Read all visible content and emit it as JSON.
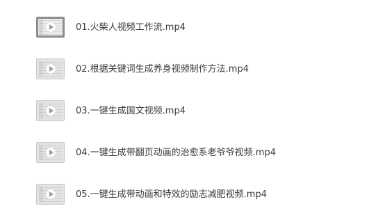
{
  "files": [
    {
      "name": "01.火柴人视频工作流.mp4",
      "thumbnail_icon": "video-thumbnail-icon"
    },
    {
      "name": "02.根据关键词生成养身视频制作方法.mp4",
      "thumbnail_icon": "video-thumbnail-icon"
    },
    {
      "name": "03.一键生成国文视频.mp4",
      "thumbnail_icon": "video-thumbnail-icon"
    },
    {
      "name": "04.一键生成带翻页动画的治愈系老爷爷视频.mp4",
      "thumbnail_icon": "video-thumbnail-icon"
    },
    {
      "name": "05.一键生成带动画和特效的励志减肥视频.mp4",
      "thumbnail_icon": "video-thumbnail-icon"
    }
  ],
  "colors": {
    "background": "#ffffff",
    "text": "#3a3a3a",
    "thumbnail_border_selected": "#8c8c8c"
  }
}
